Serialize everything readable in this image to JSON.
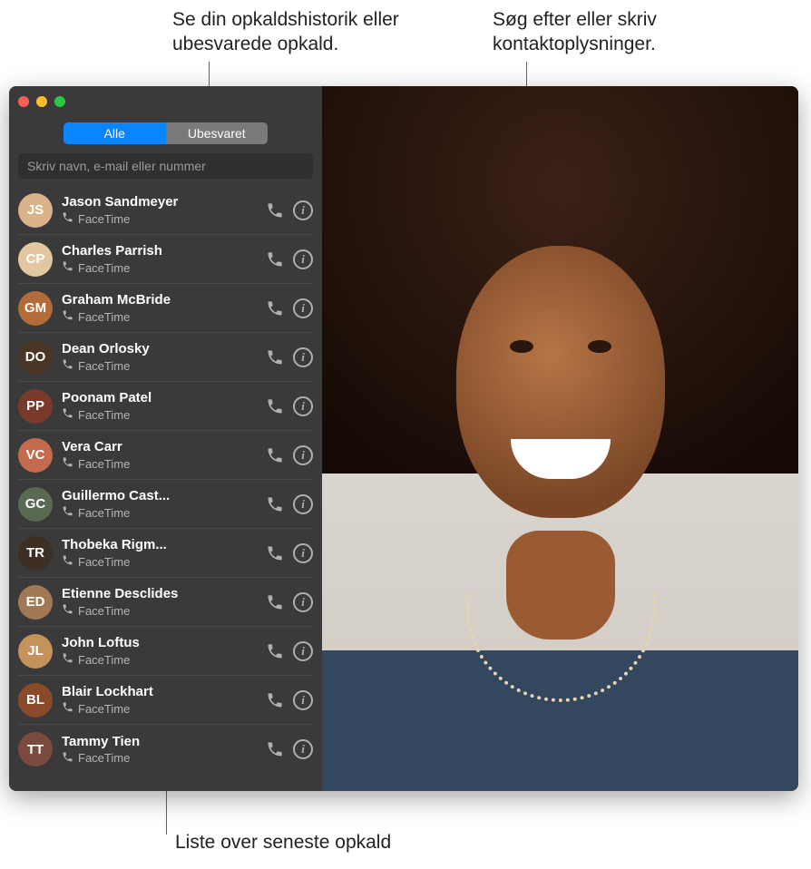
{
  "callouts": {
    "history": "Se din opkaldshistorik eller ubesvarede opkald.",
    "search": "Søg efter eller skriv kontaktoplysninger.",
    "list": "Liste over seneste opkald"
  },
  "tabs": {
    "all": "Alle",
    "missed": "Ubesvaret"
  },
  "search_placeholder": "Skriv navn, e-mail eller nummer",
  "sub_label": "FaceTime",
  "info_glyph": "i",
  "contacts": [
    {
      "name": "Jason Sandmeyer",
      "avatar_bg": "#d9b38a"
    },
    {
      "name": "Charles Parrish",
      "avatar_bg": "#e3c7a0"
    },
    {
      "name": "Graham McBride",
      "avatar_bg": "#b36b3a"
    },
    {
      "name": "Dean Orlosky",
      "avatar_bg": "#4a3624"
    },
    {
      "name": "Poonam Patel",
      "avatar_bg": "#7a3a2a"
    },
    {
      "name": "Vera Carr",
      "avatar_bg": "#c46a4d"
    },
    {
      "name": "Guillermo Cast...",
      "avatar_bg": "#5a6a52"
    },
    {
      "name": "Thobeka Rigm...",
      "avatar_bg": "#3d2f23"
    },
    {
      "name": "Etienne Desclides",
      "avatar_bg": "#a07a56"
    },
    {
      "name": "John Loftus",
      "avatar_bg": "#c4925a"
    },
    {
      "name": "Blair Lockhart",
      "avatar_bg": "#8a4a2a"
    },
    {
      "name": "Tammy Tien",
      "avatar_bg": "#7a4a3e"
    }
  ]
}
